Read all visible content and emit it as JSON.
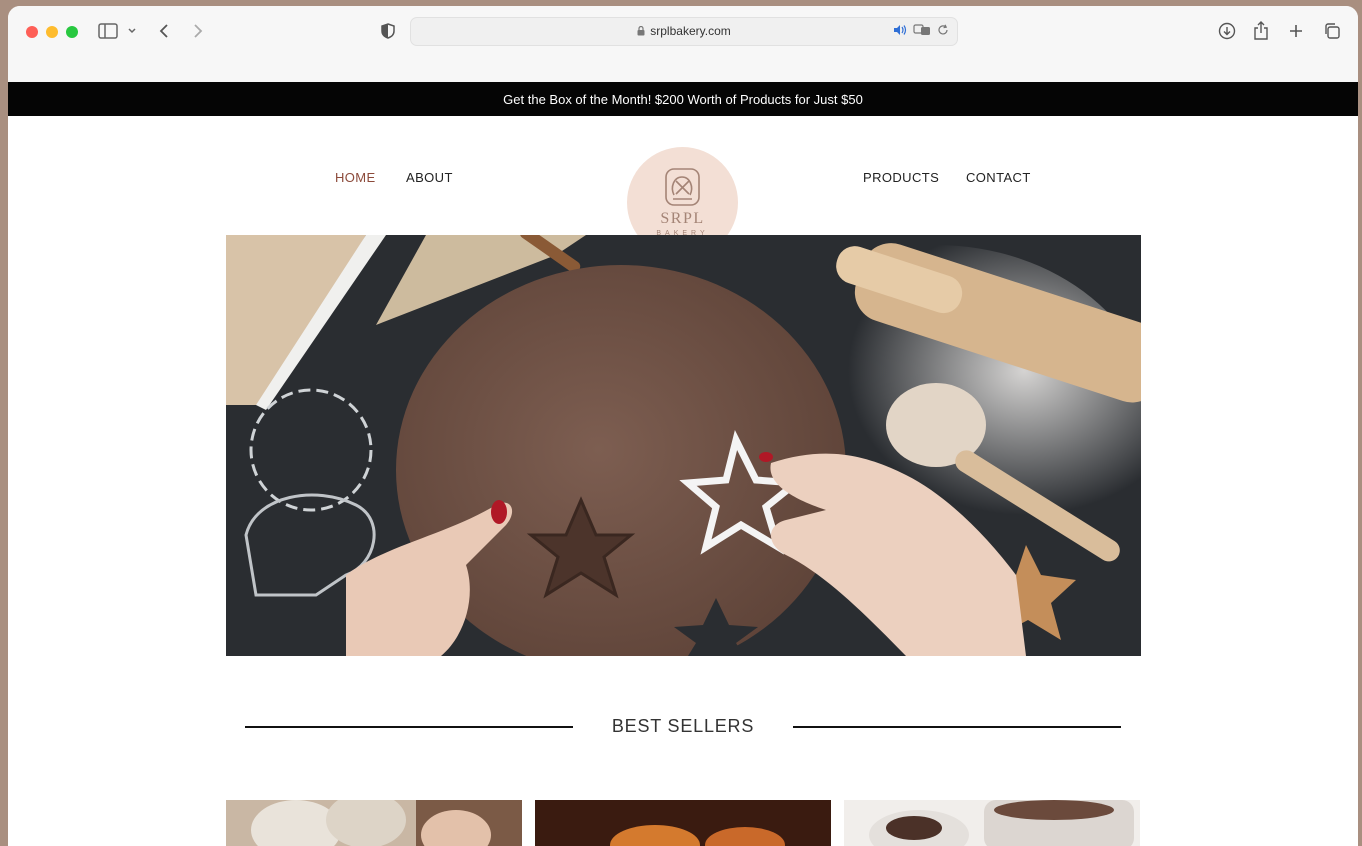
{
  "browser": {
    "url": "srplbakery.com",
    "icons": [
      "sidebar-icon",
      "chevron-down-icon",
      "back-icon",
      "forward-icon",
      "shield-icon",
      "lock-icon",
      "speaker-icon",
      "translate-icon",
      "reload-icon",
      "download-icon",
      "share-icon",
      "new-tab-icon",
      "tabs-overview-icon"
    ]
  },
  "banner": {
    "text": "Get the Box of the Month! $200 Worth of Products for Just $50"
  },
  "nav": {
    "home": "HOME",
    "about": "ABOUT",
    "products": "PRODUCTS",
    "contact": "CONTACT"
  },
  "logo": {
    "name": "SRPL",
    "sub": "BAKERY"
  },
  "section": {
    "best_sellers": "BEST SELLERS"
  },
  "colors": {
    "accent": "#8c4a3a",
    "logo_bg": "#f3dfd5",
    "banner_bg": "#050505"
  }
}
